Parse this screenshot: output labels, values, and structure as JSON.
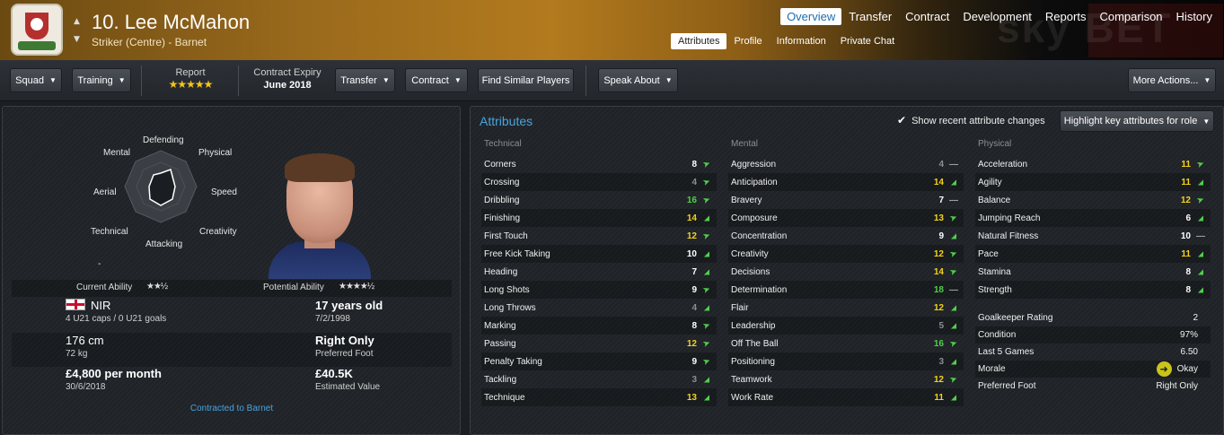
{
  "header": {
    "player_name": "10. Lee McMahon",
    "player_sub": "Striker (Centre) - Barnet",
    "nav": [
      "Overview",
      "Transfer",
      "Contract",
      "Development",
      "Reports",
      "Comparison",
      "History"
    ],
    "nav_active": 0,
    "subnav": [
      "Attributes",
      "Profile",
      "Information",
      "Private Chat"
    ],
    "subnav_active": 0,
    "watermark": "sky BET"
  },
  "toolbar": {
    "squad": "Squad",
    "training": "Training",
    "report_label": "Report",
    "report_stars": "★★★★★",
    "contract_expiry_label": "Contract Expiry",
    "contract_expiry_value": "June 2018",
    "transfer": "Transfer",
    "contract": "Contract",
    "find_similar": "Find Similar Players",
    "speak_about": "Speak About",
    "more_actions": "More Actions..."
  },
  "profile": {
    "radar_labels": {
      "defending": "Defending",
      "physical": "Physical",
      "speed": "Speed",
      "creativity": "Creativity",
      "attacking": "Attacking",
      "technical": "Technical",
      "aerial": "Aerial",
      "mental": "Mental"
    },
    "radar_dash": "-",
    "current_ability_label": "Current Ability",
    "current_ability_stars": "★★½",
    "potential_ability_label": "Potential Ability",
    "potential_ability_stars": "★★★★½",
    "nation": "NIR",
    "caps": "4 U21 caps / 0 U21 goals",
    "age": "17 years old",
    "dob": "7/2/1998",
    "height": "176 cm",
    "weight": "72 kg",
    "foot": "Right Only",
    "foot_label": "Preferred Foot",
    "wage": "£4,800 per month",
    "contract_end": "30/6/2018",
    "value": "£40.5K",
    "value_label": "Estimated Value",
    "contracted": "Contracted to Barnet"
  },
  "attributes": {
    "title": "Attributes",
    "show_changes_label": "Show recent attribute changes",
    "highlight_label": "Highlight key attributes for role",
    "technical_header": "Technical",
    "mental_header": "Mental",
    "physical_header": "Physical",
    "technical": [
      {
        "name": "Corners",
        "value": "8",
        "color": "wh",
        "trend": "up"
      },
      {
        "name": "Crossing",
        "value": "4",
        "color": "gy",
        "trend": "up"
      },
      {
        "name": "Dribbling",
        "value": "16",
        "color": "gr",
        "trend": "up"
      },
      {
        "name": "Finishing",
        "value": "14",
        "color": "hi",
        "trend": "dn"
      },
      {
        "name": "First Touch",
        "value": "12",
        "color": "hi",
        "trend": "up"
      },
      {
        "name": "Free Kick Taking",
        "value": "10",
        "color": "wh",
        "trend": "dn"
      },
      {
        "name": "Heading",
        "value": "7",
        "color": "wh",
        "trend": "dn"
      },
      {
        "name": "Long Shots",
        "value": "9",
        "color": "wh",
        "trend": "up"
      },
      {
        "name": "Long Throws",
        "value": "4",
        "color": "gy",
        "trend": "dn"
      },
      {
        "name": "Marking",
        "value": "8",
        "color": "wh",
        "trend": "up"
      },
      {
        "name": "Passing",
        "value": "12",
        "color": "hi",
        "trend": "up"
      },
      {
        "name": "Penalty Taking",
        "value": "9",
        "color": "wh",
        "trend": "up"
      },
      {
        "name": "Tackling",
        "value": "3",
        "color": "gy",
        "trend": "dn"
      },
      {
        "name": "Technique",
        "value": "13",
        "color": "hi",
        "trend": "dn"
      }
    ],
    "mental": [
      {
        "name": "Aggression",
        "value": "4",
        "color": "gy",
        "trend": "flat"
      },
      {
        "name": "Anticipation",
        "value": "14",
        "color": "hi",
        "trend": "dn"
      },
      {
        "name": "Bravery",
        "value": "7",
        "color": "wh",
        "trend": "flat"
      },
      {
        "name": "Composure",
        "value": "13",
        "color": "hi",
        "trend": "up"
      },
      {
        "name": "Concentration",
        "value": "9",
        "color": "wh",
        "trend": "dn"
      },
      {
        "name": "Creativity",
        "value": "12",
        "color": "hi",
        "trend": "up"
      },
      {
        "name": "Decisions",
        "value": "14",
        "color": "hi",
        "trend": "up"
      },
      {
        "name": "Determination",
        "value": "18",
        "color": "gr",
        "trend": "flat"
      },
      {
        "name": "Flair",
        "value": "12",
        "color": "hi",
        "trend": "dn"
      },
      {
        "name": "Leadership",
        "value": "5",
        "color": "gy",
        "trend": "dn"
      },
      {
        "name": "Off The Ball",
        "value": "16",
        "color": "gr",
        "trend": "up"
      },
      {
        "name": "Positioning",
        "value": "3",
        "color": "gy",
        "trend": "dn"
      },
      {
        "name": "Teamwork",
        "value": "12",
        "color": "hi",
        "trend": "up"
      },
      {
        "name": "Work Rate",
        "value": "11",
        "color": "hi",
        "trend": "dn"
      }
    ],
    "physical": [
      {
        "name": "Acceleration",
        "value": "11",
        "color": "hi",
        "trend": "up"
      },
      {
        "name": "Agility",
        "value": "11",
        "color": "hi",
        "trend": "dn"
      },
      {
        "name": "Balance",
        "value": "12",
        "color": "hi",
        "trend": "up"
      },
      {
        "name": "Jumping Reach",
        "value": "6",
        "color": "wh",
        "trend": "dn"
      },
      {
        "name": "Natural Fitness",
        "value": "10",
        "color": "wh",
        "trend": "flat"
      },
      {
        "name": "Pace",
        "value": "11",
        "color": "hi",
        "trend": "dn"
      },
      {
        "name": "Stamina",
        "value": "8",
        "color": "wh",
        "trend": "dn"
      },
      {
        "name": "Strength",
        "value": "8",
        "color": "wh",
        "trend": "dn"
      }
    ],
    "summary": [
      {
        "name": "Goalkeeper Rating",
        "value": "2"
      },
      {
        "name": "Condition",
        "value": "97%"
      },
      {
        "name": "Last 5 Games",
        "value": "6.50"
      },
      {
        "name": "Morale",
        "value": "Okay",
        "icon": "arrow-right-icon"
      },
      {
        "name": "Preferred Foot",
        "value": "Right Only"
      }
    ]
  },
  "colors": {
    "accent": "#4aa3df",
    "high": "#f5d21b",
    "very_high": "#4fd04a",
    "low": "#8a8f96"
  }
}
